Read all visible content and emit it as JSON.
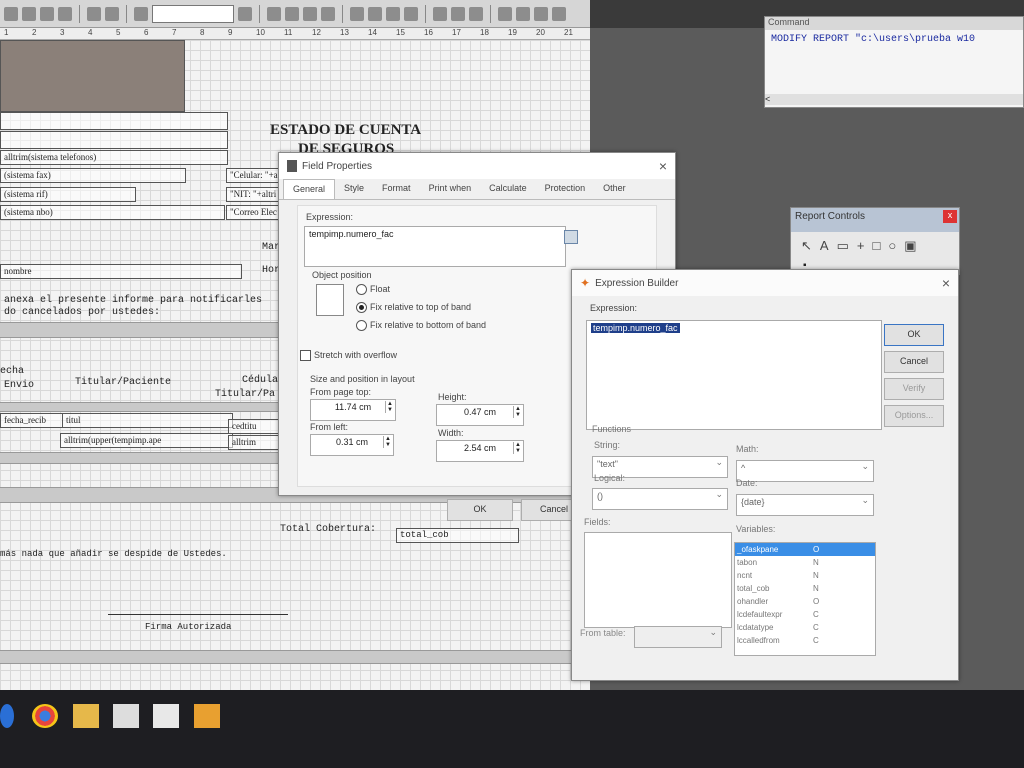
{
  "ruler": {
    "ticks": [
      "1",
      "2",
      "3",
      "4",
      "5",
      "6",
      "7",
      "8",
      "9",
      "10",
      "11",
      "12",
      "13",
      "14",
      "15",
      "16",
      "17",
      "18",
      "19",
      "20",
      "21"
    ]
  },
  "report": {
    "title_line1": "ESTADO DE CUENTA",
    "title_line2": "DE SEGUROS",
    "fields": {
      "telefonos": "alltrim(sistema telefonos)",
      "fax": "(sistema fax)",
      "rif": "(sistema rif)",
      "nbo": "(sistema nbo)",
      "celular": "\"Celular: \"+a",
      "nit": "\"NIT: \"+altri",
      "correo": "\"Correo Elec",
      "nombre": "nombre",
      "fecha_recib": "fecha_recib",
      "titul": "titul",
      "cedtitu": "cedtitu",
      "titular_expr": "alltrim(upper(tempimp.ape",
      "alltrim2": "alltrim",
      "total_cob": "total_cob"
    },
    "labels": {
      "mara": "Mara",
      "hora": "Hora",
      "anexa": "anexa el presente informe para notificarles",
      "cancelados": "do cancelados por ustedes:",
      "fecha": "echa",
      "envio": "Envio",
      "titular_paciente": "Titular/Paciente",
      "cedula": "Cédula",
      "titular_pa": "Titular/Pa",
      "total_cobertura": "Total Cobertura:",
      "despide": "más nada que añadir se despide de Ustedes.",
      "firma": "Firma Autorizada"
    }
  },
  "command_window": {
    "title": "Command",
    "text": "MODIFY REPORT \"c:\\users\\prueba w10",
    "scroll_left": "<"
  },
  "report_controls": {
    "title": "Report Controls",
    "close": "x"
  },
  "field_properties": {
    "title": "Field Properties",
    "tabs": [
      "General",
      "Style",
      "Format",
      "Print when",
      "Calculate",
      "Protection",
      "Other"
    ],
    "expression_label": "Expression:",
    "expression_value": "tempimp.numero_fac",
    "object_position_label": "Object position",
    "radio_float": "Float",
    "radio_fix_top": "Fix relative to top of band",
    "radio_fix_bottom": "Fix relative to bottom of band",
    "stretch_label": "Stretch with overflow",
    "size_position_label": "Size and position in layout",
    "from_page_top_label": "From page top:",
    "from_page_top_value": "11.74 cm",
    "height_label": "Height:",
    "height_value": "0.47 cm",
    "from_left_label": "From left:",
    "from_left_value": "0.31 cm",
    "width_label": "Width:",
    "width_value": "2.54 cm",
    "ok": "OK",
    "cancel": "Cancel"
  },
  "expression_builder": {
    "title": "Expression Builder",
    "expression_label": "Expression:",
    "expression_value": "tempimp.numero_fac",
    "functions_label": "Functions",
    "string_label": "String:",
    "string_value": "\"text\"",
    "math_label": "Math:",
    "math_value": "^",
    "logical_label": "Logical:",
    "logical_value": "()",
    "date_label": "Date:",
    "date_value": "{date}",
    "fields_label": "Fields:",
    "variables_label": "Variables:",
    "variables": [
      {
        "name": "_ofaskpane",
        "type": "O"
      },
      {
        "name": "tabon",
        "type": "N"
      },
      {
        "name": "ncnt",
        "type": "N"
      },
      {
        "name": "total_cob",
        "type": "N"
      },
      {
        "name": "ohandler",
        "type": "O"
      },
      {
        "name": "lcdefaultexpr",
        "type": "C"
      },
      {
        "name": "lcdatatype",
        "type": "C"
      },
      {
        "name": "lccalledfrom",
        "type": "C"
      }
    ],
    "from_table_label": "From table:",
    "ok": "OK",
    "cancel": "Cancel",
    "verify": "Verify",
    "options": "Options..."
  },
  "colors": {
    "accent": "#3a75c4",
    "selected_variable_bg": "#3a8ee6"
  }
}
